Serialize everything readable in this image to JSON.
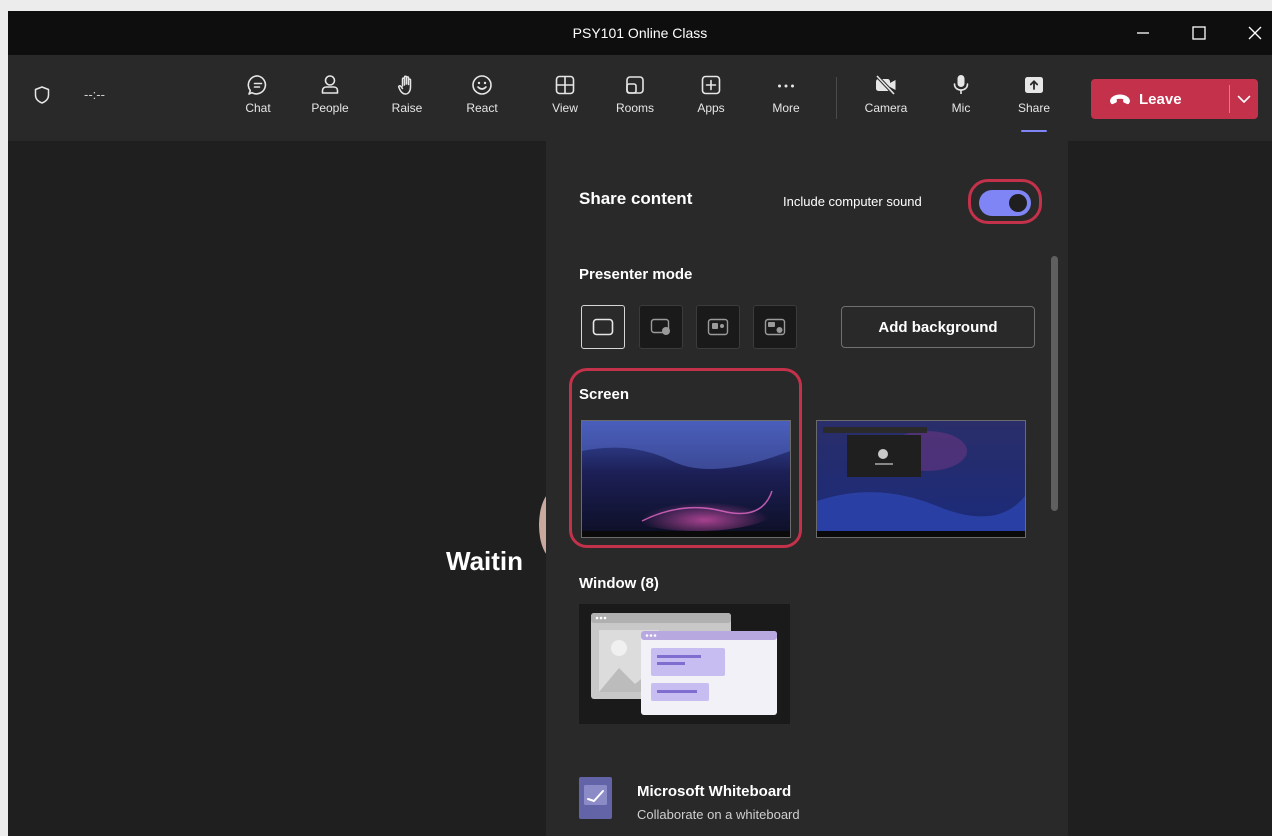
{
  "window": {
    "title": "PSY101 Online Class"
  },
  "meeting": {
    "timer": "--:--"
  },
  "toolbar": {
    "items": [
      {
        "label": "Chat",
        "icon": "chat-icon"
      },
      {
        "label": "People",
        "icon": "people-icon"
      },
      {
        "label": "Raise",
        "icon": "raise-hand-icon"
      },
      {
        "label": "React",
        "icon": "react-icon"
      },
      {
        "label": "View",
        "icon": "view-icon"
      },
      {
        "label": "Rooms",
        "icon": "rooms-icon"
      },
      {
        "label": "Apps",
        "icon": "apps-icon"
      },
      {
        "label": "More",
        "icon": "more-icon"
      },
      {
        "label": "Camera",
        "icon": "camera-off-icon"
      },
      {
        "label": "Mic",
        "icon": "mic-icon"
      },
      {
        "label": "Share",
        "icon": "share-icon",
        "active": true
      }
    ],
    "leave_label": "Leave"
  },
  "stage": {
    "waiting_text": "Waitin"
  },
  "share_panel": {
    "title": "Share content",
    "include_sound_label": "Include computer sound",
    "include_sound_on": true,
    "presenter_mode_label": "Presenter mode",
    "add_background_label": "Add background",
    "screen_label": "Screen",
    "window_label": "Window (8)",
    "whiteboard_title": "Microsoft Whiteboard",
    "whiteboard_subtitle": "Collaborate on a whiteboard"
  },
  "colors": {
    "accent": "#7f85f5",
    "leave": "#c4314b",
    "highlight": "#c4314b"
  }
}
